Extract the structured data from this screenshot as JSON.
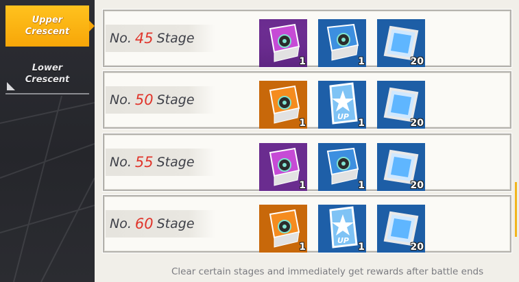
{
  "tabs": [
    {
      "line1": "Upper",
      "line2": "Crescent",
      "active": true
    },
    {
      "line1": "Lower",
      "line2": "Crescent",
      "active": false
    }
  ],
  "stages": [
    {
      "prefix": "No.",
      "number": "45",
      "suffix": "Stage",
      "rewards": [
        {
          "icon": "purple-gear-chest-icon",
          "count": "1"
        },
        {
          "icon": "blue-gear-chest-icon",
          "count": "1"
        },
        {
          "icon": "blue-frame-chip-icon",
          "count": "20"
        }
      ]
    },
    {
      "prefix": "No.",
      "number": "50",
      "suffix": "Stage",
      "rewards": [
        {
          "icon": "orange-gear-chest-icon",
          "count": "1"
        },
        {
          "icon": "blue-star-up-card-icon",
          "count": "1"
        },
        {
          "icon": "blue-frame-chip-icon",
          "count": "20"
        }
      ]
    },
    {
      "prefix": "No.",
      "number": "55",
      "suffix": "Stage",
      "rewards": [
        {
          "icon": "purple-gear-chest-icon",
          "count": "1"
        },
        {
          "icon": "blue-gear-chest-icon",
          "count": "1"
        },
        {
          "icon": "blue-frame-chip-icon",
          "count": "20"
        }
      ]
    },
    {
      "prefix": "No.",
      "number": "60",
      "suffix": "Stage",
      "rewards": [
        {
          "icon": "orange-gear-chest-icon",
          "count": "1"
        },
        {
          "icon": "blue-star-up-card-icon",
          "count": "1"
        },
        {
          "icon": "blue-frame-chip-icon",
          "count": "20"
        }
      ]
    }
  ],
  "footer_note": "Clear certain stages and immediately get rewards after battle ends",
  "colors": {
    "accent": "#f7a608",
    "stage_number": "#e0352b",
    "sidebar": "#2a2b30"
  }
}
